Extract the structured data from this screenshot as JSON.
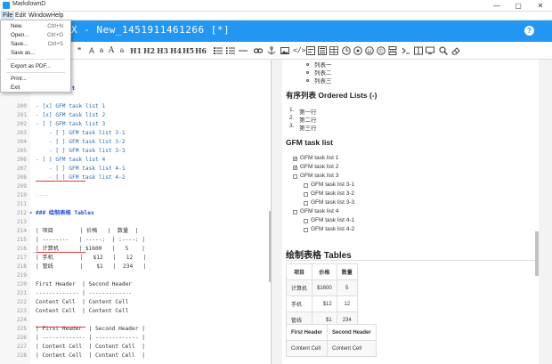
{
  "window": {
    "title": "MarkdownD",
    "minimize": "—",
    "maximize": "▢",
    "close": "✕"
  },
  "menubar": {
    "items": [
      "File",
      "Edit",
      "Window",
      "Help"
    ]
  },
  "file_menu": {
    "items": [
      {
        "label": "New",
        "shortcut": "Ctrl+N"
      },
      {
        "label": "Open...",
        "shortcut": "Ctrl+O"
      },
      {
        "label": "Save...",
        "shortcut": "Ctrl+S"
      },
      {
        "label": "Save as...",
        "shortcut": ""
      },
      {
        "label": "Export as PDF...",
        "shortcut": ""
      },
      {
        "label": "Print...",
        "shortcut": ""
      },
      {
        "label": "Exit",
        "shortcut": ""
      }
    ]
  },
  "header": {
    "title": "X - New_1451911461266 [*]",
    "help": "?"
  },
  "toolbar": {
    "quote": "❝",
    "large_a": "A",
    "normal_a": "a",
    "big_a": "A",
    "small_a": "a",
    "h1": "H1",
    "h2": "H2",
    "h3": "H3",
    "h4": "H4",
    "h5": "H5",
    "h6": "H6"
  },
  "editor": {
    "lines": [
      {
        "n": "",
        "t": "",
        "c": ""
      },
      {
        "n": "",
        "t": "",
        "c": ""
      },
      {
        "n": "",
        "t": "k list",
        "c": "heading"
      },
      {
        "n": "",
        "t": "",
        "c": ""
      },
      {
        "n": "200",
        "t": "- [x] GFM task list 1",
        "c": "blue"
      },
      {
        "n": "201",
        "t": "- [x] GFM task list 2",
        "c": "blue"
      },
      {
        "n": "202",
        "t": "- [ ] GFM task list 3",
        "c": "blue"
      },
      {
        "n": "203",
        "t": "    - [ ] GFM task list 3-1",
        "c": "blue"
      },
      {
        "n": "204",
        "t": "    - [ ] GFM task list 3-2",
        "c": "blue"
      },
      {
        "n": "205",
        "t": "    - [ ] GFM task list 3-3",
        "c": "blue"
      },
      {
        "n": "206",
        "t": "- [ ] GFM task list 4",
        "c": "blue"
      },
      {
        "n": "207",
        "t": "    - [ ] GFM task list 4-1",
        "c": "blue"
      },
      {
        "n": "208",
        "t": "    - [ ] GFM task list 4-2",
        "c": "blue"
      },
      {
        "n": "209",
        "t": "",
        "c": ""
      },
      {
        "n": "210",
        "t": "----",
        "c": "gray"
      },
      {
        "n": "211",
        "t": "",
        "c": ""
      },
      {
        "n": "212",
        "t": "### 绘制表格 Tables",
        "c": "heading"
      },
      {
        "n": "213",
        "t": "",
        "c": ""
      },
      {
        "n": "214",
        "t": "| 项目        | 价格   |  数量  |",
        "c": ""
      },
      {
        "n": "215",
        "t": "| --------   | -----:  | :----: |",
        "c": ""
      },
      {
        "n": "216",
        "t": "| 计算机      | $1600   |   5    |",
        "c": ""
      },
      {
        "n": "217",
        "t": "| 手机        |   $12   |   12   |",
        "c": ""
      },
      {
        "n": "218",
        "t": "| 管线        |    $1   |  234   |",
        "c": ""
      },
      {
        "n": "219",
        "t": "",
        "c": ""
      },
      {
        "n": "220",
        "t": "First Header  | Second Header",
        "c": ""
      },
      {
        "n": "221",
        "t": "------------- | -------------",
        "c": ""
      },
      {
        "n": "222",
        "t": "Content Cell  | Content Cell",
        "c": ""
      },
      {
        "n": "223",
        "t": "Content Cell  | Content Cell",
        "c": ""
      },
      {
        "n": "224",
        "t": "",
        "c": ""
      },
      {
        "n": "225",
        "t": "| First Header  | Second Header |",
        "c": ""
      },
      {
        "n": "226",
        "t": "| ------------- | ------------- |",
        "c": ""
      },
      {
        "n": "227",
        "t": "| Content Cell  | Content Cell  |",
        "c": ""
      },
      {
        "n": "228",
        "t": "| Content Cell  | Content Cell  |",
        "c": ""
      }
    ]
  },
  "preview": {
    "bullets": [
      "列表一",
      "列表二",
      "列表三"
    ],
    "ordered_heading": "有序列表 Ordered Lists (-)",
    "ordered": [
      "第一行",
      "第二行",
      "第三行"
    ],
    "ordered_nums": [
      "1.",
      "2.",
      "3."
    ],
    "task_heading": "GFM task list",
    "tasks": [
      {
        "label": "GFM task list 1",
        "checked": true,
        "level": 0
      },
      {
        "label": "GFM task list 2",
        "checked": true,
        "level": 0
      },
      {
        "label": "GFM task list 3",
        "checked": false,
        "level": 0
      },
      {
        "label": "GFM task list 3-1",
        "checked": false,
        "level": 1
      },
      {
        "label": "GFM task list 3-2",
        "checked": false,
        "level": 1
      },
      {
        "label": "GFM task list 3-3",
        "checked": false,
        "level": 1
      },
      {
        "label": "GFM task list 4",
        "checked": false,
        "level": 0
      },
      {
        "label": "GFM task list 4-1",
        "checked": false,
        "level": 1
      },
      {
        "label": "GFM task list 4-2",
        "checked": false,
        "level": 1
      }
    ],
    "tables_heading": "绘制表格 Tables",
    "table1": {
      "headers": [
        "项目",
        "价格",
        "数量"
      ],
      "rows": [
        [
          "计算机",
          "$1600",
          "5"
        ],
        [
          "手机",
          "$12",
          "12"
        ],
        [
          "管线",
          "$1",
          "234"
        ]
      ]
    },
    "table2": {
      "headers": [
        "First Header",
        "Second Header"
      ],
      "rows": [
        [
          "Content Cell",
          "Content Cell"
        ]
      ]
    }
  },
  "colors": {
    "accent": "#2196f3",
    "heading_link": "#1e4fd8",
    "error_underline": "#e53935"
  }
}
